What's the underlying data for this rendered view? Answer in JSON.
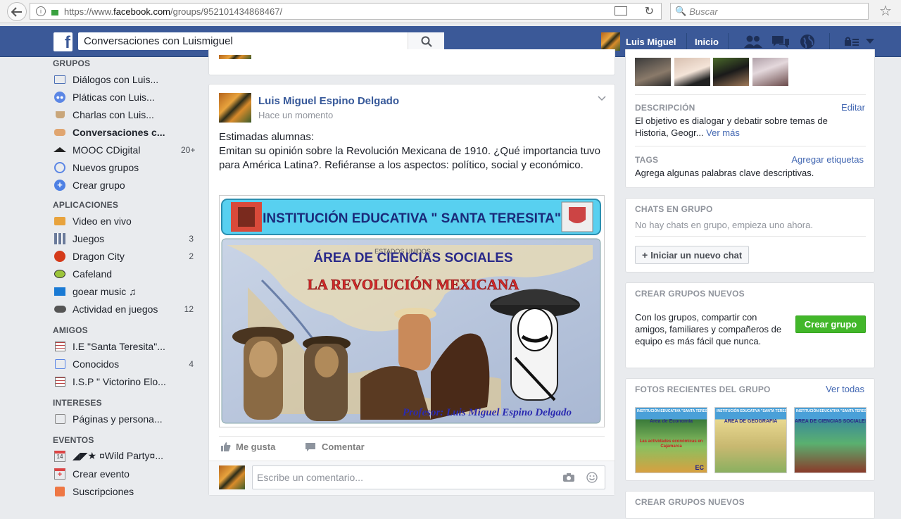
{
  "browser": {
    "url_scheme": "https://www.",
    "url_host": "facebook.com",
    "url_path": "/groups/952101434868467/",
    "search_placeholder": "Buscar"
  },
  "fb": {
    "logo": "f",
    "search_value": "Conversaciones con Luismiguel",
    "user_name": "Luis Miguel",
    "home": "Inicio"
  },
  "left": {
    "sections": {
      "groups": "GRUPOS",
      "apps": "APLICACIONES",
      "friends": "AMIGOS",
      "interests": "INTERESES",
      "events": "EVENTOS"
    },
    "groups": [
      {
        "label": "Diálogos con Luis...",
        "count": ""
      },
      {
        "label": "Pláticas con Luis...",
        "count": ""
      },
      {
        "label": "Charlas con Luis...",
        "count": ""
      },
      {
        "label": "Conversaciones c...",
        "count": ""
      },
      {
        "label": "MOOC CDigital",
        "count": "20+"
      },
      {
        "label": "Nuevos grupos",
        "count": ""
      },
      {
        "label": "Crear grupo",
        "count": ""
      }
    ],
    "apps": [
      {
        "label": "Video en vivo",
        "count": ""
      },
      {
        "label": "Juegos",
        "count": "3"
      },
      {
        "label": "Dragon City",
        "count": "2"
      },
      {
        "label": "Cafeland",
        "count": ""
      },
      {
        "label": "goear music ♫",
        "count": ""
      },
      {
        "label": "Actividad en juegos",
        "count": "12"
      }
    ],
    "friends": [
      {
        "label": "I.E \"Santa Teresita\"...",
        "count": ""
      },
      {
        "label": "Conocidos",
        "count": "4"
      },
      {
        "label": "I.S.P \" Victorino Elo...",
        "count": ""
      }
    ],
    "interests": [
      {
        "label": "Páginas y persona...",
        "count": ""
      }
    ],
    "events": [
      {
        "label": "◢◤★ ¤Wild Party¤...",
        "count": "",
        "date": "14"
      },
      {
        "label": "Crear evento",
        "count": ""
      },
      {
        "label": "Suscripciones",
        "count": ""
      }
    ]
  },
  "post": {
    "author": "Luis Miguel Espino Delgado",
    "time": "Hace un momento",
    "line1": "Estimadas alumnas:",
    "line2": "Emitan su opinión sobre la Revolución Mexicana de 1910. ¿Qué importancia tuvo para América Latina?. Refiéranse a los aspectos: político, social y económico.",
    "image": {
      "banner": "INSTITUCIÓN EDUCATIVA \" SANTA TERESITA\"",
      "area": "ÁREA DE CIENCIAS SOCIALES",
      "title": "LA REVOLUCIÓN MEXICANA",
      "professor": "Profesor: Luis Miguel Espino Delgado",
      "map_label": "ESTADOS UNIDOS"
    },
    "like": "Me gusta",
    "comment": "Comentar",
    "comment_placeholder": "Escribe un comentario..."
  },
  "right": {
    "description_head": "DESCRIPCIÓN",
    "edit": "Editar",
    "description": "El objetivo es dialogar y debatir sobre temas de Historia, Geogr...",
    "see_more": "Ver más",
    "tags_head": "TAGS",
    "add_tags": "Agregar etiquetas",
    "tags_text": "Agrega algunas palabras clave descriptivas.",
    "chats_head": "CHATS EN GRUPO",
    "chats_text": "No hay chats en grupo, empieza uno ahora.",
    "new_chat": "Iniciar un nuevo chat",
    "create_head": "CREAR GRUPOS NUEVOS",
    "create_text": "Con los grupos, compartir con amigos, familiares y compañeros de equipo es más fácil que nunca.",
    "create_btn": "Crear grupo",
    "photos_head": "FOTOS RECIENTES DEL GRUPO",
    "see_all": "Ver todas",
    "photos": [
      {
        "top": "INSTITUCIÓN EDUCATIVA \"SANTA TERESITA\"",
        "title": "Área de Economía",
        "sub": "Las actividades económicas en Cajamarca",
        "tag": "EC"
      },
      {
        "top": "INSTITUCIÓN EDUCATIVA \"SANTA TERESITA\"",
        "title": "ÁREA DE GEOGRAFÍA",
        "sub": "",
        "tag": ""
      },
      {
        "top": "INSTITUCIÓN EDUCATIVA \"SANTA TERESITA\"",
        "title": "ÁREA DE CIENCIAS SOCIALES",
        "sub": "",
        "tag": ""
      }
    ],
    "create_head2": "CREAR GRUPOS NUEVOS"
  },
  "colors": {
    "fb_blue": "#3b5998",
    "link": "#4267b2",
    "green": "#42b72a",
    "bg": "#e9ebee"
  }
}
